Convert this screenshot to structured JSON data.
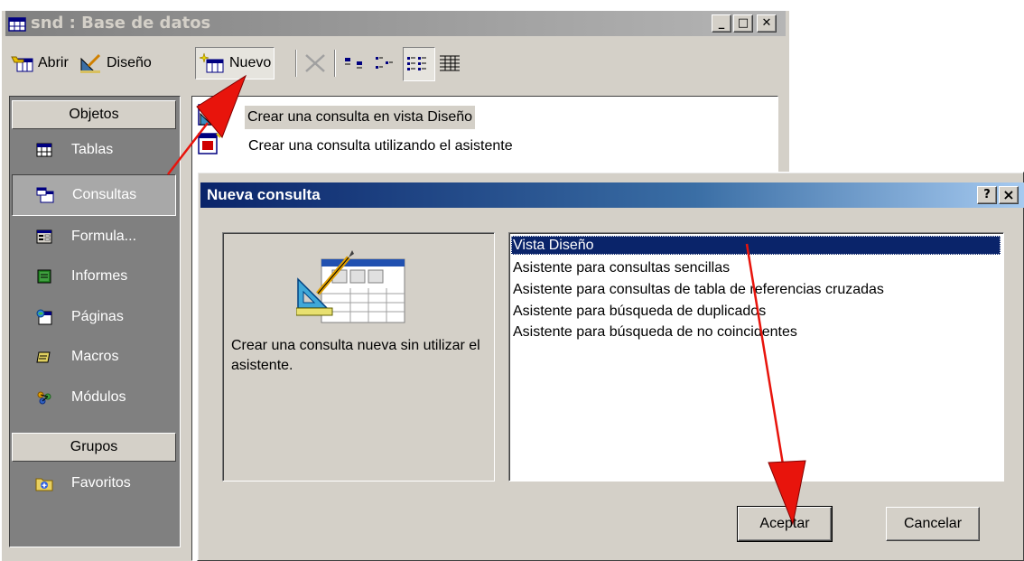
{
  "window": {
    "title": "snd : Base de datos",
    "controls": [
      "minimize",
      "maximize",
      "close"
    ]
  },
  "toolbar": {
    "open_label": "Abrir",
    "design_label": "Diseño",
    "new_label": "Nuevo"
  },
  "sidebar": {
    "objects_header": "Objetos",
    "groups_header": "Grupos",
    "items": [
      {
        "label": "Tablas",
        "icon": "table-icon",
        "selected": false
      },
      {
        "label": "Consultas",
        "icon": "query-icon",
        "selected": true
      },
      {
        "label": "Formula...",
        "icon": "form-icon",
        "selected": false
      },
      {
        "label": "Informes",
        "icon": "report-icon",
        "selected": false
      },
      {
        "label": "Páginas",
        "icon": "page-icon",
        "selected": false
      },
      {
        "label": "Macros",
        "icon": "macro-icon",
        "selected": false
      },
      {
        "label": "Módulos",
        "icon": "module-icon",
        "selected": false
      }
    ],
    "groups": [
      {
        "label": "Favoritos",
        "icon": "favorites-folder-icon"
      }
    ]
  },
  "list": {
    "items": [
      "Crear una consulta en vista Diseño",
      "Crear una consulta utilizando el asistente"
    ]
  },
  "dialog": {
    "title": "Nueva consulta",
    "help_label": "?",
    "close_label": "×",
    "description": "Crear una consulta nueva sin utilizar el asistente.",
    "options": [
      {
        "label": "Vista Diseño",
        "selected": true
      },
      {
        "label": "Asistente para consultas sencillas",
        "selected": false
      },
      {
        "label": "Asistente para consultas de tabla de referencias cruzadas",
        "selected": false
      },
      {
        "label": "Asistente para búsqueda de duplicados",
        "selected": false
      },
      {
        "label": "Asistente para búsqueda de no coincidentes",
        "selected": false
      }
    ],
    "ok_label": "Aceptar",
    "cancel_label": "Cancelar"
  },
  "colors": {
    "dialog_title_bar": "#0a246a",
    "selection": "#0a246a",
    "face": "#d4d0c8",
    "annotation_arrow": "#e8140c"
  }
}
